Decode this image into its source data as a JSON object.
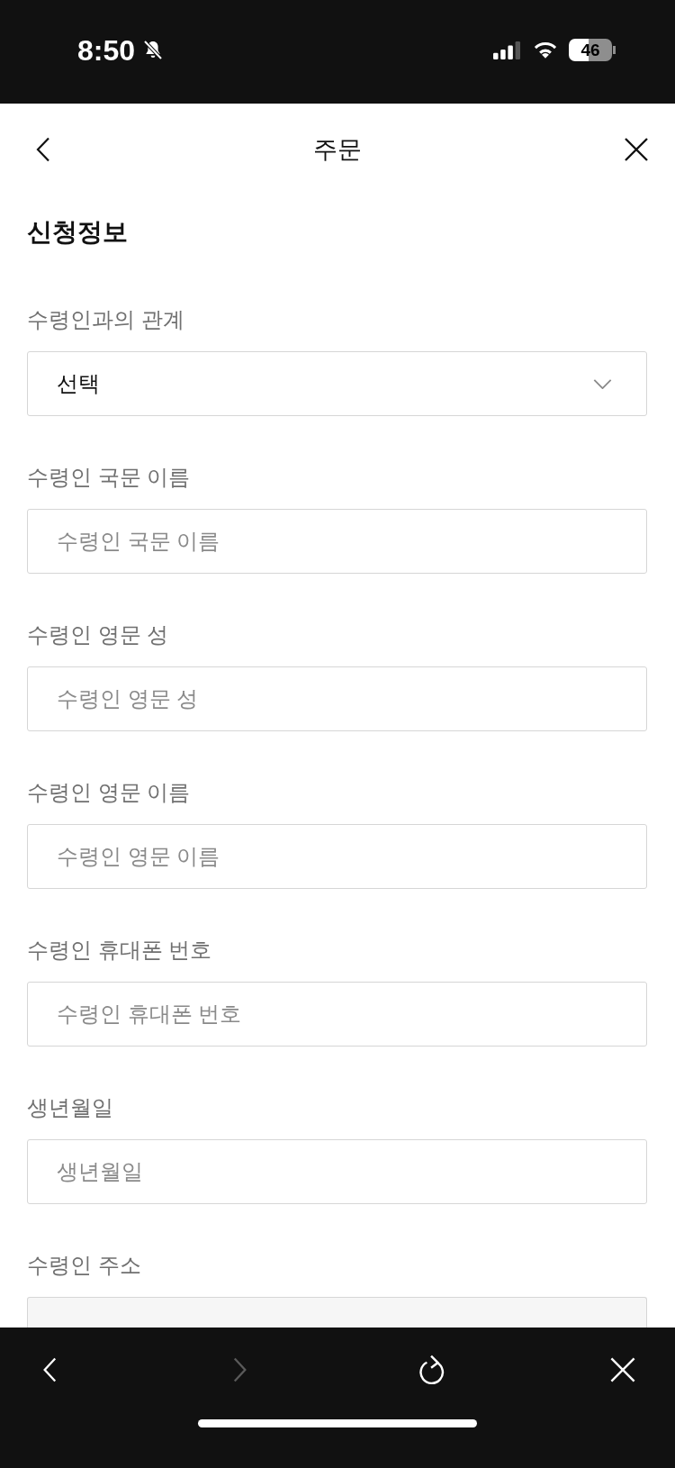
{
  "status_bar": {
    "time": "8:50",
    "battery": "46"
  },
  "header": {
    "title": "주문"
  },
  "section": {
    "title": "신청정보"
  },
  "fields": [
    {
      "label": "수령인과의 관계",
      "kind": "select",
      "value": "선택"
    },
    {
      "label": "수령인 국문 이름",
      "kind": "text",
      "placeholder": "수령인 국문 이름"
    },
    {
      "label": "수령인 영문 성",
      "kind": "text",
      "placeholder": "수령인 영문 성"
    },
    {
      "label": "수령인 영문 이름",
      "kind": "text",
      "placeholder": "수령인 영문 이름"
    },
    {
      "label": "수령인 휴대폰 번호",
      "kind": "text",
      "placeholder": "수령인 휴대폰 번호"
    },
    {
      "label": "생년월일",
      "kind": "text",
      "placeholder": "생년월일"
    },
    {
      "label": "수령인 주소",
      "kind": "address"
    }
  ],
  "toolbar": [
    {
      "kind": "back",
      "disabled": false
    },
    {
      "kind": "forward",
      "disabled": true
    },
    {
      "kind": "reload",
      "disabled": false
    },
    {
      "kind": "close",
      "disabled": false
    }
  ]
}
